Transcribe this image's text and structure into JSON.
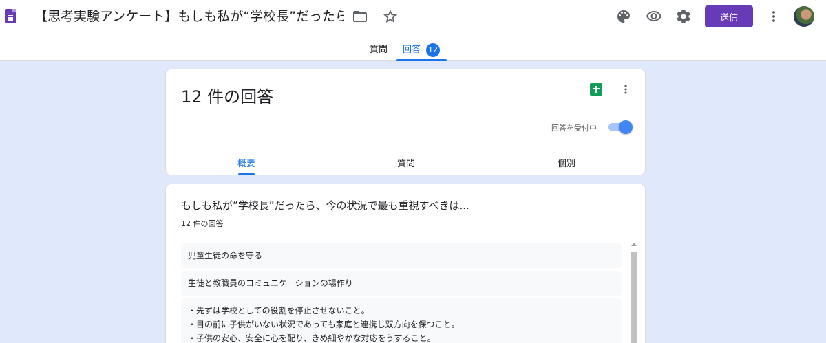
{
  "header": {
    "title": "【思考実験アンケート】もしも私が“学校長”だったら...",
    "send_label": "送信"
  },
  "top_tabs": {
    "questions": "質問",
    "responses": "回答",
    "response_badge": "12"
  },
  "summary_card": {
    "count_title": "12 件の回答",
    "accepting_label": "回答を受付中",
    "accepting_on": true,
    "tabs": [
      "概要",
      "質問",
      "個別"
    ]
  },
  "question_card": {
    "title": "もしも私が“学校長”だったら、今の状況で最も重視すべきは...",
    "count": "12 件の回答",
    "answers": [
      "児童生徒の命を守る",
      "生徒と教職員のコミュニケーションの場作り"
    ],
    "multi_answer_lines": [
      "・先ずは学校としての役割を停止させないこと。",
      "・目の前に子供がいない状況であっても家庭と連携し双方向を保つこと。",
      "・子供の安心、安全に心を配り、きめ細やかな対応をうすること。"
    ]
  },
  "colors": {
    "accent": "#1a73e8",
    "brand": "#673ab7",
    "background": "#e0e9fb"
  },
  "icons": [
    "form-icon",
    "folder-icon",
    "star-icon",
    "palette-icon",
    "eye-icon",
    "gear-icon",
    "more-vert-icon",
    "sheets-icon"
  ]
}
